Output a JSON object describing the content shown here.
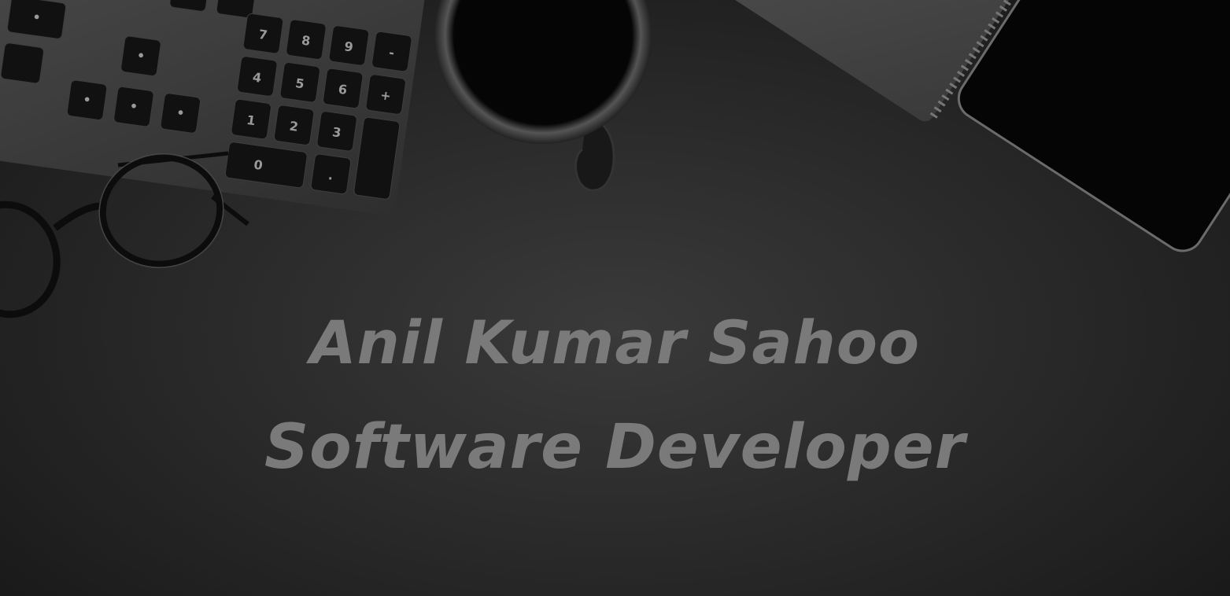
{
  "hero": {
    "name": "Anil Kumar Sahoo",
    "role": "Software Developer"
  },
  "keyboard": {
    "keys": [
      "+",
      "7",
      "8",
      "9",
      "-",
      "4",
      "5",
      "6",
      "+",
      "1",
      "2",
      "3",
      "0",
      ".",
      "⌫",
      "⇥",
      "•"
    ]
  },
  "colors": {
    "background": "#262626",
    "text": "#7a7a7a"
  }
}
